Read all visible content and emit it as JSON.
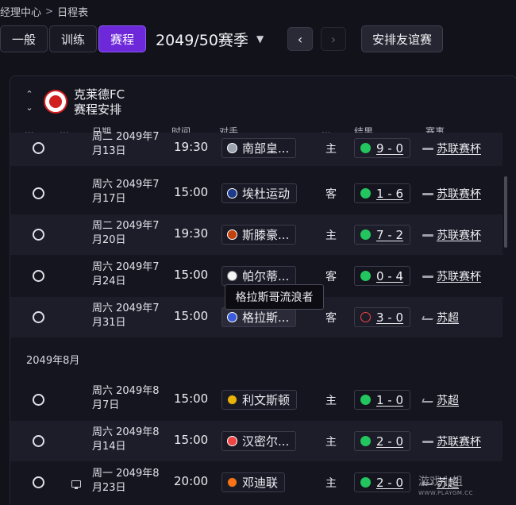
{
  "breadcrumb": {
    "parent": "经理中心",
    "separator": ">",
    "current": "日程表"
  },
  "toolbar": {
    "tabs": [
      {
        "label": "一般"
      },
      {
        "label": "训练"
      },
      {
        "label": "赛程"
      }
    ],
    "active_tab": "赛程",
    "season": "2049/50赛季",
    "friendly_button": "安排友谊赛"
  },
  "panel": {
    "club_name": "克莱德FC",
    "title": "赛程安排"
  },
  "columns": [
    "...",
    "...",
    "日期",
    "时间",
    "对手",
    "...",
    "结果",
    "赛事"
  ],
  "month_label": "2049年8月",
  "tooltip": "格拉斯哥流浪者",
  "fixtures": [
    {
      "date": "周二 2049年7月13日",
      "time": "19:30",
      "opponent": "南部皇...",
      "badge_color": "#9ca3af",
      "venue": "主",
      "result": "9 - 0",
      "outcome": "win",
      "competition": "苏联赛杯"
    },
    {
      "date": "周六 2049年7月17日",
      "time": "15:00",
      "opponent": "埃杜运动",
      "badge_color": "#1e3a8a",
      "venue": "客",
      "result": "1 - 6",
      "outcome": "win",
      "competition": "苏联赛杯"
    },
    {
      "date": "周二 2049年7月20日",
      "time": "19:30",
      "opponent": "斯滕豪...",
      "badge_color": "#c2410c",
      "venue": "主",
      "result": "7 - 2",
      "outcome": "win",
      "competition": "苏联赛杯"
    },
    {
      "date": "周六 2049年7月24日",
      "time": "15:00",
      "opponent": "帕尔蒂...",
      "badge_color": "#f5f5f5",
      "venue": "客",
      "result": "0 - 4",
      "outcome": "win",
      "competition": "苏联赛杯"
    },
    {
      "date": "周六 2049年7月31日",
      "time": "15:00",
      "opponent": "格拉斯...",
      "badge_color": "#3b5bdb",
      "venue": "客",
      "result": "3 - 0",
      "outcome": "loss",
      "competition": "苏超"
    },
    {
      "date": "周六 2049年8月7日",
      "time": "15:00",
      "opponent": "利文斯顿",
      "badge_color": "#eab308",
      "venue": "主",
      "result": "1 - 0",
      "outcome": "win",
      "competition": "苏超"
    },
    {
      "date": "周六 2049年8月14日",
      "time": "15:00",
      "opponent": "汉密尔...",
      "badge_color": "#ef4444",
      "venue": "主",
      "result": "2 - 0",
      "outcome": "win",
      "competition": "苏联赛杯"
    },
    {
      "date": "周一 2049年8月23日",
      "time": "20:00",
      "opponent": "邓迪联",
      "badge_color": "#f97316",
      "venue": "主",
      "result": "2 - 0",
      "outcome": "win",
      "competition": "苏超"
    }
  ],
  "watermark": {
    "text": "游戏小组",
    "url": "WWW.PLAYGM.CC"
  }
}
